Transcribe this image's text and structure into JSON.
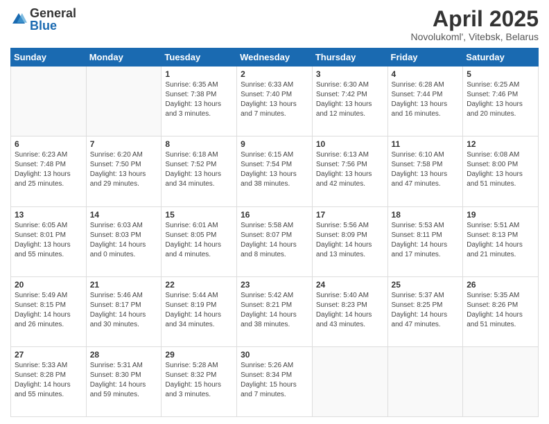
{
  "header": {
    "logo_general": "General",
    "logo_blue": "Blue",
    "month_title": "April 2025",
    "location": "Novolukoml', Vitebsk, Belarus"
  },
  "weekdays": [
    "Sunday",
    "Monday",
    "Tuesday",
    "Wednesday",
    "Thursday",
    "Friday",
    "Saturday"
  ],
  "weeks": [
    [
      {
        "day": "",
        "info": ""
      },
      {
        "day": "",
        "info": ""
      },
      {
        "day": "1",
        "info": "Sunrise: 6:35 AM\nSunset: 7:38 PM\nDaylight: 13 hours and 3 minutes."
      },
      {
        "day": "2",
        "info": "Sunrise: 6:33 AM\nSunset: 7:40 PM\nDaylight: 13 hours and 7 minutes."
      },
      {
        "day": "3",
        "info": "Sunrise: 6:30 AM\nSunset: 7:42 PM\nDaylight: 13 hours and 12 minutes."
      },
      {
        "day": "4",
        "info": "Sunrise: 6:28 AM\nSunset: 7:44 PM\nDaylight: 13 hours and 16 minutes."
      },
      {
        "day": "5",
        "info": "Sunrise: 6:25 AM\nSunset: 7:46 PM\nDaylight: 13 hours and 20 minutes."
      }
    ],
    [
      {
        "day": "6",
        "info": "Sunrise: 6:23 AM\nSunset: 7:48 PM\nDaylight: 13 hours and 25 minutes."
      },
      {
        "day": "7",
        "info": "Sunrise: 6:20 AM\nSunset: 7:50 PM\nDaylight: 13 hours and 29 minutes."
      },
      {
        "day": "8",
        "info": "Sunrise: 6:18 AM\nSunset: 7:52 PM\nDaylight: 13 hours and 34 minutes."
      },
      {
        "day": "9",
        "info": "Sunrise: 6:15 AM\nSunset: 7:54 PM\nDaylight: 13 hours and 38 minutes."
      },
      {
        "day": "10",
        "info": "Sunrise: 6:13 AM\nSunset: 7:56 PM\nDaylight: 13 hours and 42 minutes."
      },
      {
        "day": "11",
        "info": "Sunrise: 6:10 AM\nSunset: 7:58 PM\nDaylight: 13 hours and 47 minutes."
      },
      {
        "day": "12",
        "info": "Sunrise: 6:08 AM\nSunset: 8:00 PM\nDaylight: 13 hours and 51 minutes."
      }
    ],
    [
      {
        "day": "13",
        "info": "Sunrise: 6:05 AM\nSunset: 8:01 PM\nDaylight: 13 hours and 55 minutes."
      },
      {
        "day": "14",
        "info": "Sunrise: 6:03 AM\nSunset: 8:03 PM\nDaylight: 14 hours and 0 minutes."
      },
      {
        "day": "15",
        "info": "Sunrise: 6:01 AM\nSunset: 8:05 PM\nDaylight: 14 hours and 4 minutes."
      },
      {
        "day": "16",
        "info": "Sunrise: 5:58 AM\nSunset: 8:07 PM\nDaylight: 14 hours and 8 minutes."
      },
      {
        "day": "17",
        "info": "Sunrise: 5:56 AM\nSunset: 8:09 PM\nDaylight: 14 hours and 13 minutes."
      },
      {
        "day": "18",
        "info": "Sunrise: 5:53 AM\nSunset: 8:11 PM\nDaylight: 14 hours and 17 minutes."
      },
      {
        "day": "19",
        "info": "Sunrise: 5:51 AM\nSunset: 8:13 PM\nDaylight: 14 hours and 21 minutes."
      }
    ],
    [
      {
        "day": "20",
        "info": "Sunrise: 5:49 AM\nSunset: 8:15 PM\nDaylight: 14 hours and 26 minutes."
      },
      {
        "day": "21",
        "info": "Sunrise: 5:46 AM\nSunset: 8:17 PM\nDaylight: 14 hours and 30 minutes."
      },
      {
        "day": "22",
        "info": "Sunrise: 5:44 AM\nSunset: 8:19 PM\nDaylight: 14 hours and 34 minutes."
      },
      {
        "day": "23",
        "info": "Sunrise: 5:42 AM\nSunset: 8:21 PM\nDaylight: 14 hours and 38 minutes."
      },
      {
        "day": "24",
        "info": "Sunrise: 5:40 AM\nSunset: 8:23 PM\nDaylight: 14 hours and 43 minutes."
      },
      {
        "day": "25",
        "info": "Sunrise: 5:37 AM\nSunset: 8:25 PM\nDaylight: 14 hours and 47 minutes."
      },
      {
        "day": "26",
        "info": "Sunrise: 5:35 AM\nSunset: 8:26 PM\nDaylight: 14 hours and 51 minutes."
      }
    ],
    [
      {
        "day": "27",
        "info": "Sunrise: 5:33 AM\nSunset: 8:28 PM\nDaylight: 14 hours and 55 minutes."
      },
      {
        "day": "28",
        "info": "Sunrise: 5:31 AM\nSunset: 8:30 PM\nDaylight: 14 hours and 59 minutes."
      },
      {
        "day": "29",
        "info": "Sunrise: 5:28 AM\nSunset: 8:32 PM\nDaylight: 15 hours and 3 minutes."
      },
      {
        "day": "30",
        "info": "Sunrise: 5:26 AM\nSunset: 8:34 PM\nDaylight: 15 hours and 7 minutes."
      },
      {
        "day": "",
        "info": ""
      },
      {
        "day": "",
        "info": ""
      },
      {
        "day": "",
        "info": ""
      }
    ]
  ]
}
